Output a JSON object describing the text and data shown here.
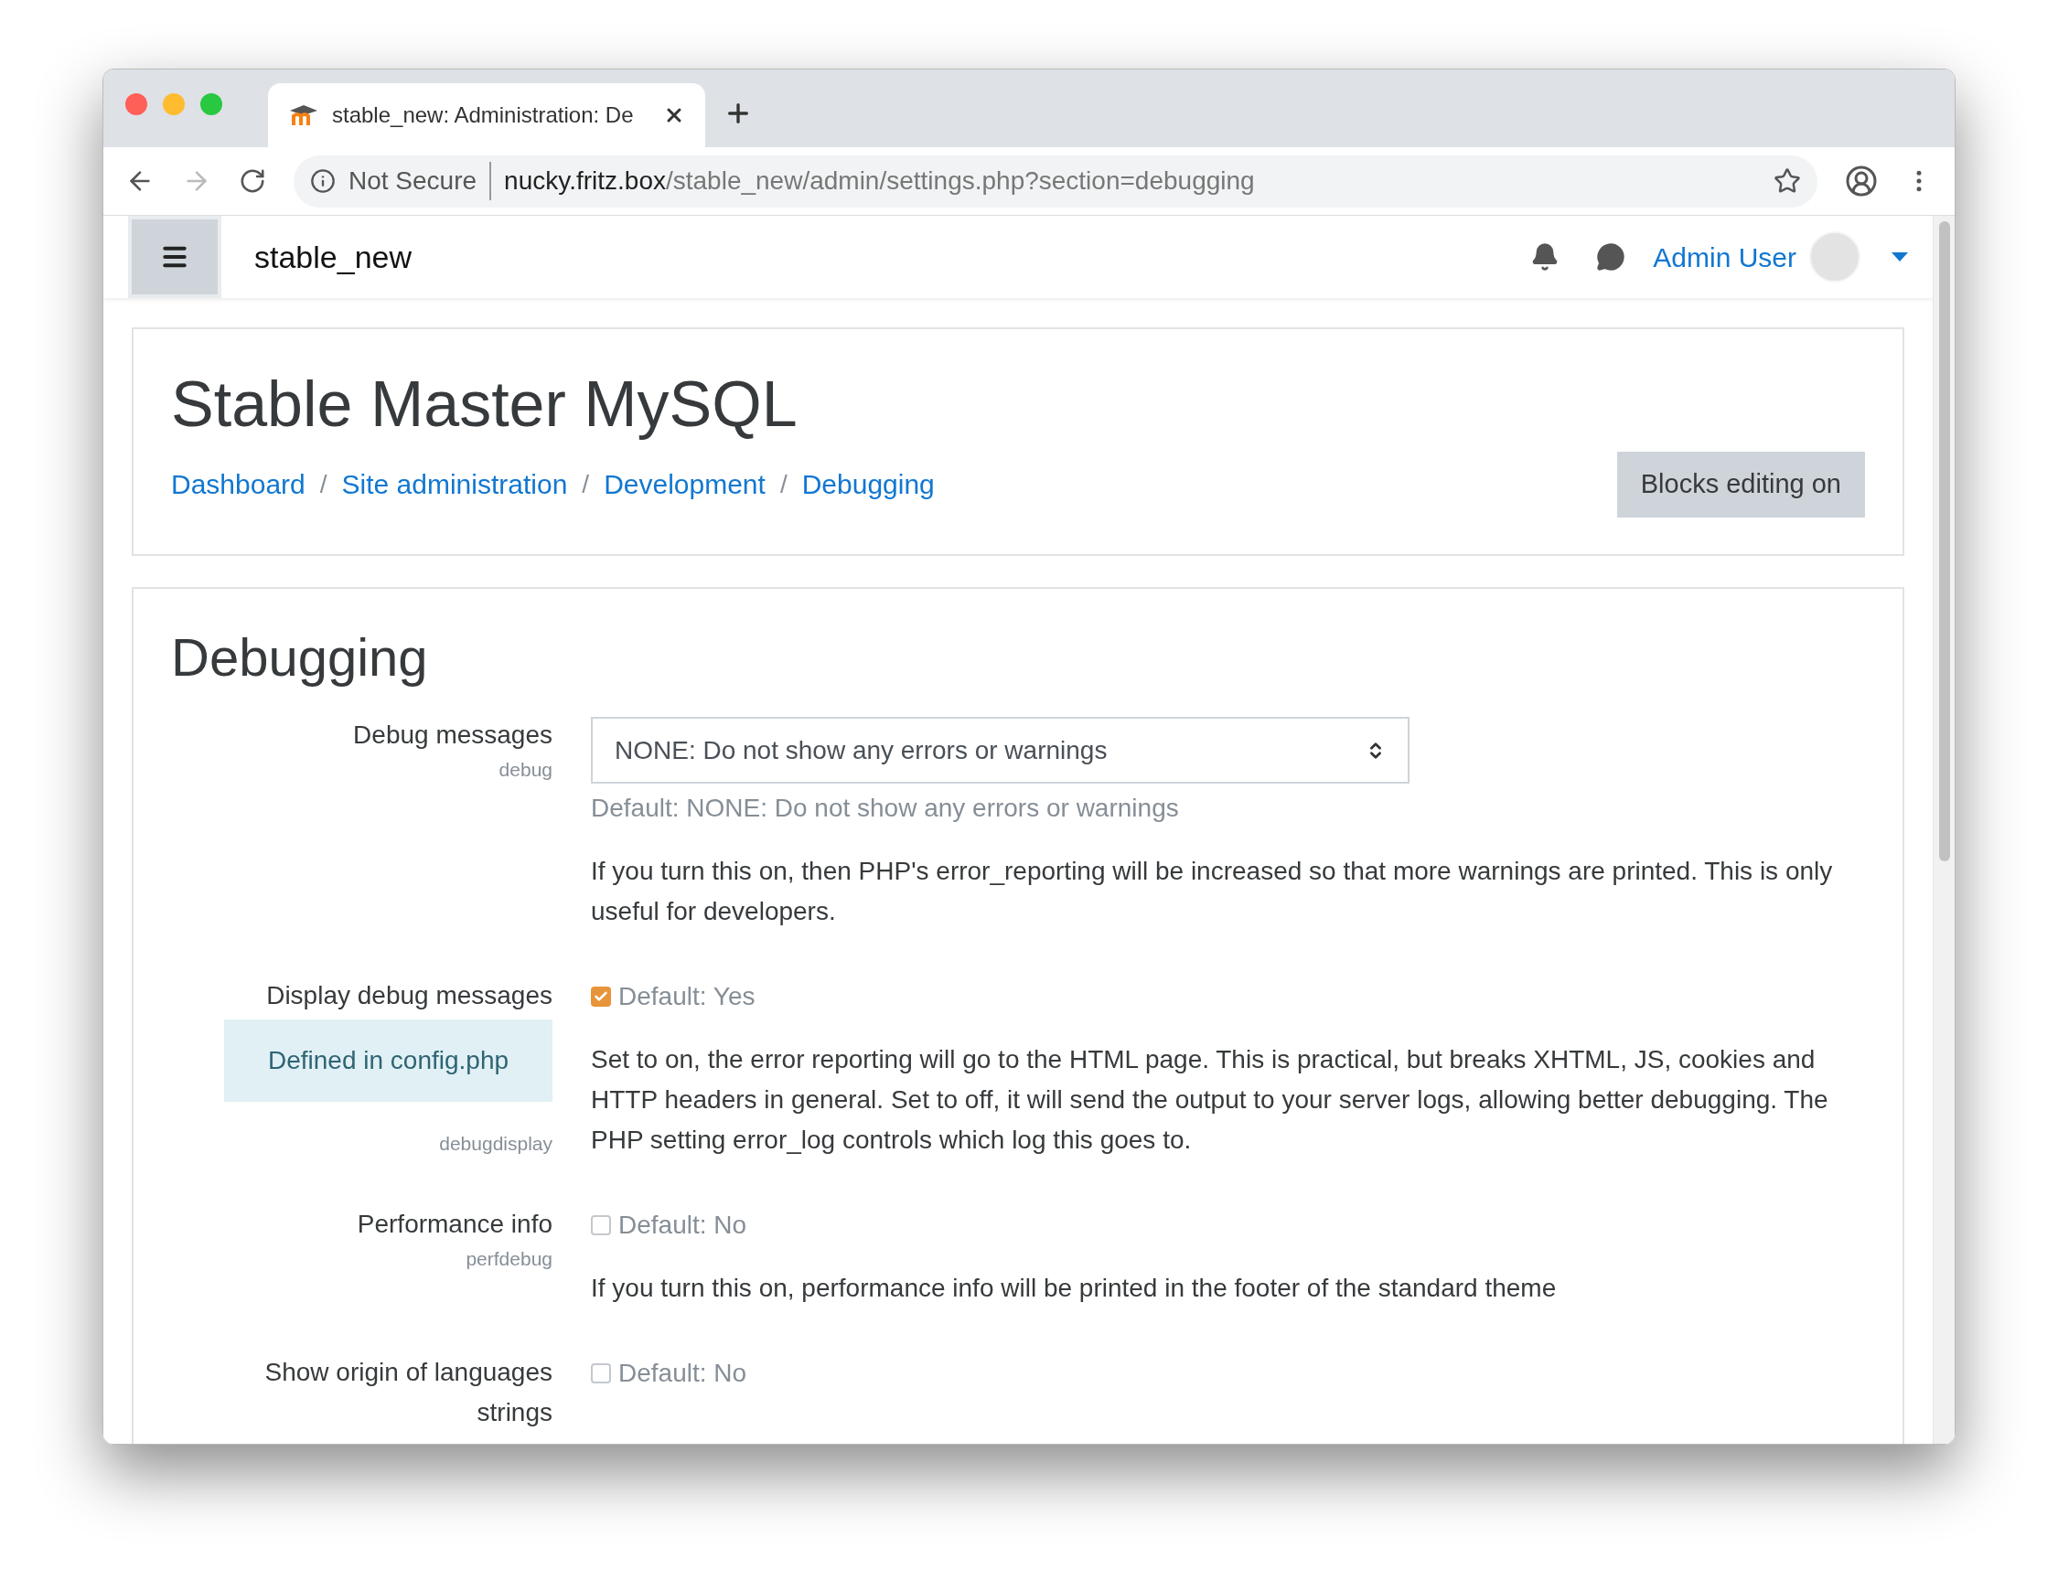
{
  "browser": {
    "tab_title": "stable_new: Administration: De",
    "security": "Not Secure",
    "url_host": "nucky.fritz.box",
    "url_path": "/stable_new/admin/settings.php?section=debugging"
  },
  "navbar": {
    "site_name": "stable_new",
    "user_name": "Admin User"
  },
  "header": {
    "title": "Stable Master MySQL",
    "breadcrumbs": [
      "Dashboard",
      "Site administration",
      "Development",
      "Debugging"
    ],
    "breadcrumb_separators": [
      "/",
      "/",
      "/"
    ],
    "button": "Blocks editing on"
  },
  "section": {
    "title": "Debugging",
    "settings": [
      {
        "kind": "select",
        "label": "Debug messages",
        "name": "debug",
        "value": "NONE: Do not show any errors or warnings",
        "default": "Default: NONE: Do not show any errors or warnings",
        "description": "If you turn this on, then PHP's error_reporting will be increased so that more warnings are printed. This is only useful for developers."
      },
      {
        "kind": "checkbox",
        "label": "Display debug messages",
        "note": "Defined in config.php",
        "name": "debugdisplay",
        "checked": true,
        "default": "Default: Yes",
        "description": "Set to on, the error reporting will go to the HTML page. This is practical, but breaks XHTML, JS, cookies and HTTP headers in general. Set to off, it will send the output to your server logs, allowing better debugging. The PHP setting error_log controls which log this goes to."
      },
      {
        "kind": "checkbox",
        "label": "Performance info",
        "name": "perfdebug",
        "checked": false,
        "default": "Default: No",
        "description": "If you turn this on, performance info will be printed in the footer of the standard theme"
      },
      {
        "kind": "checkbox",
        "label": "Show origin of languages strings",
        "checked": false,
        "default": "Default: No"
      }
    ]
  }
}
